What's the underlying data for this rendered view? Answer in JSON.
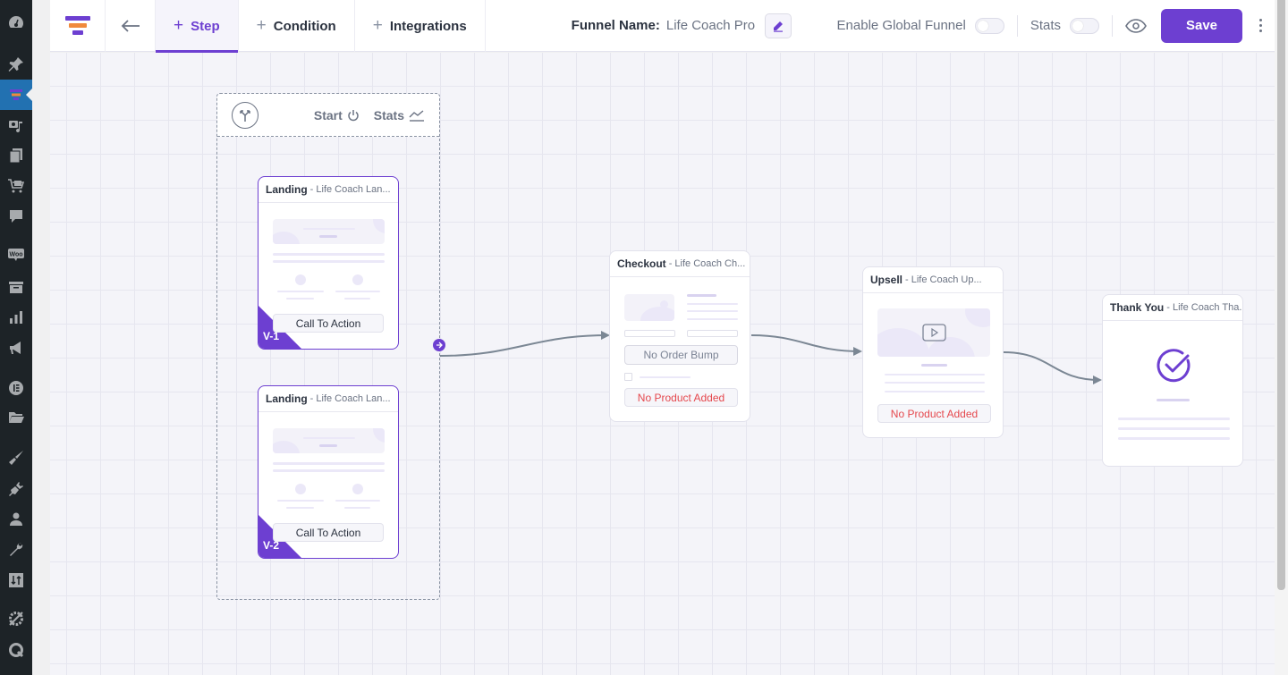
{
  "wp_sidebar": {
    "items": [
      {
        "icon": "dashboard-icon"
      },
      {
        "icon": "pin-icon"
      },
      {
        "icon": "funnel-icon",
        "active": true
      },
      {
        "icon": "media-icon"
      },
      {
        "icon": "pages-icon"
      },
      {
        "icon": "store-cart-icon"
      },
      {
        "icon": "comments-icon"
      },
      {
        "icon": "woo-icon",
        "text": "Woo"
      },
      {
        "icon": "archive-icon"
      },
      {
        "icon": "analytics-icon"
      },
      {
        "icon": "megaphone-icon"
      },
      {
        "icon": "elementor-icon"
      },
      {
        "icon": "folder-icon"
      },
      {
        "icon": "appearance-brush-icon"
      },
      {
        "icon": "plugins-icon"
      },
      {
        "icon": "users-icon"
      },
      {
        "icon": "tools-wrench-icon"
      },
      {
        "icon": "settings-sliders-icon"
      },
      {
        "icon": "gear-slash-icon"
      },
      {
        "icon": "q-logo-icon"
      }
    ]
  },
  "toolbar": {
    "logo_icon": "funnel-logo-icon",
    "back_icon": "arrow-left-icon",
    "tabs": [
      {
        "label": "Step",
        "active": true
      },
      {
        "label": "Condition",
        "active": false
      },
      {
        "label": "Integrations",
        "active": false
      }
    ],
    "funnel_name_label": "Funnel Name:",
    "funnel_name_value": "Life Coach Pro",
    "enable_global_label": "Enable Global Funnel",
    "enable_global_on": false,
    "stats_label": "Stats",
    "stats_on": false,
    "save_label": "Save",
    "accent": "#6d3fd1"
  },
  "canvas": {
    "group": {
      "start_label": "Start",
      "stats_label": "Stats"
    },
    "nodes": [
      {
        "type": "Landing",
        "name": "- Life Coach Lan...",
        "button": "Call To Action",
        "variant": "V-1"
      },
      {
        "type": "Landing",
        "name": "- Life Coach Lan...",
        "button": "Call To Action",
        "variant": "V-2"
      },
      {
        "type": "Checkout",
        "name": "- Life Coach Ch...",
        "order_bump": "No Order Bump",
        "product": "No Product Added"
      },
      {
        "type": "Upsell",
        "name": "- Life Coach Up...",
        "product": "No Product Added"
      },
      {
        "type": "Thank You",
        "name": "- Life Coach Tha..."
      }
    ],
    "edges": [
      {
        "from": "Landing group",
        "to": "Checkout"
      },
      {
        "from": "Checkout",
        "to": "Upsell"
      },
      {
        "from": "Upsell",
        "to": "Thank You"
      }
    ]
  }
}
